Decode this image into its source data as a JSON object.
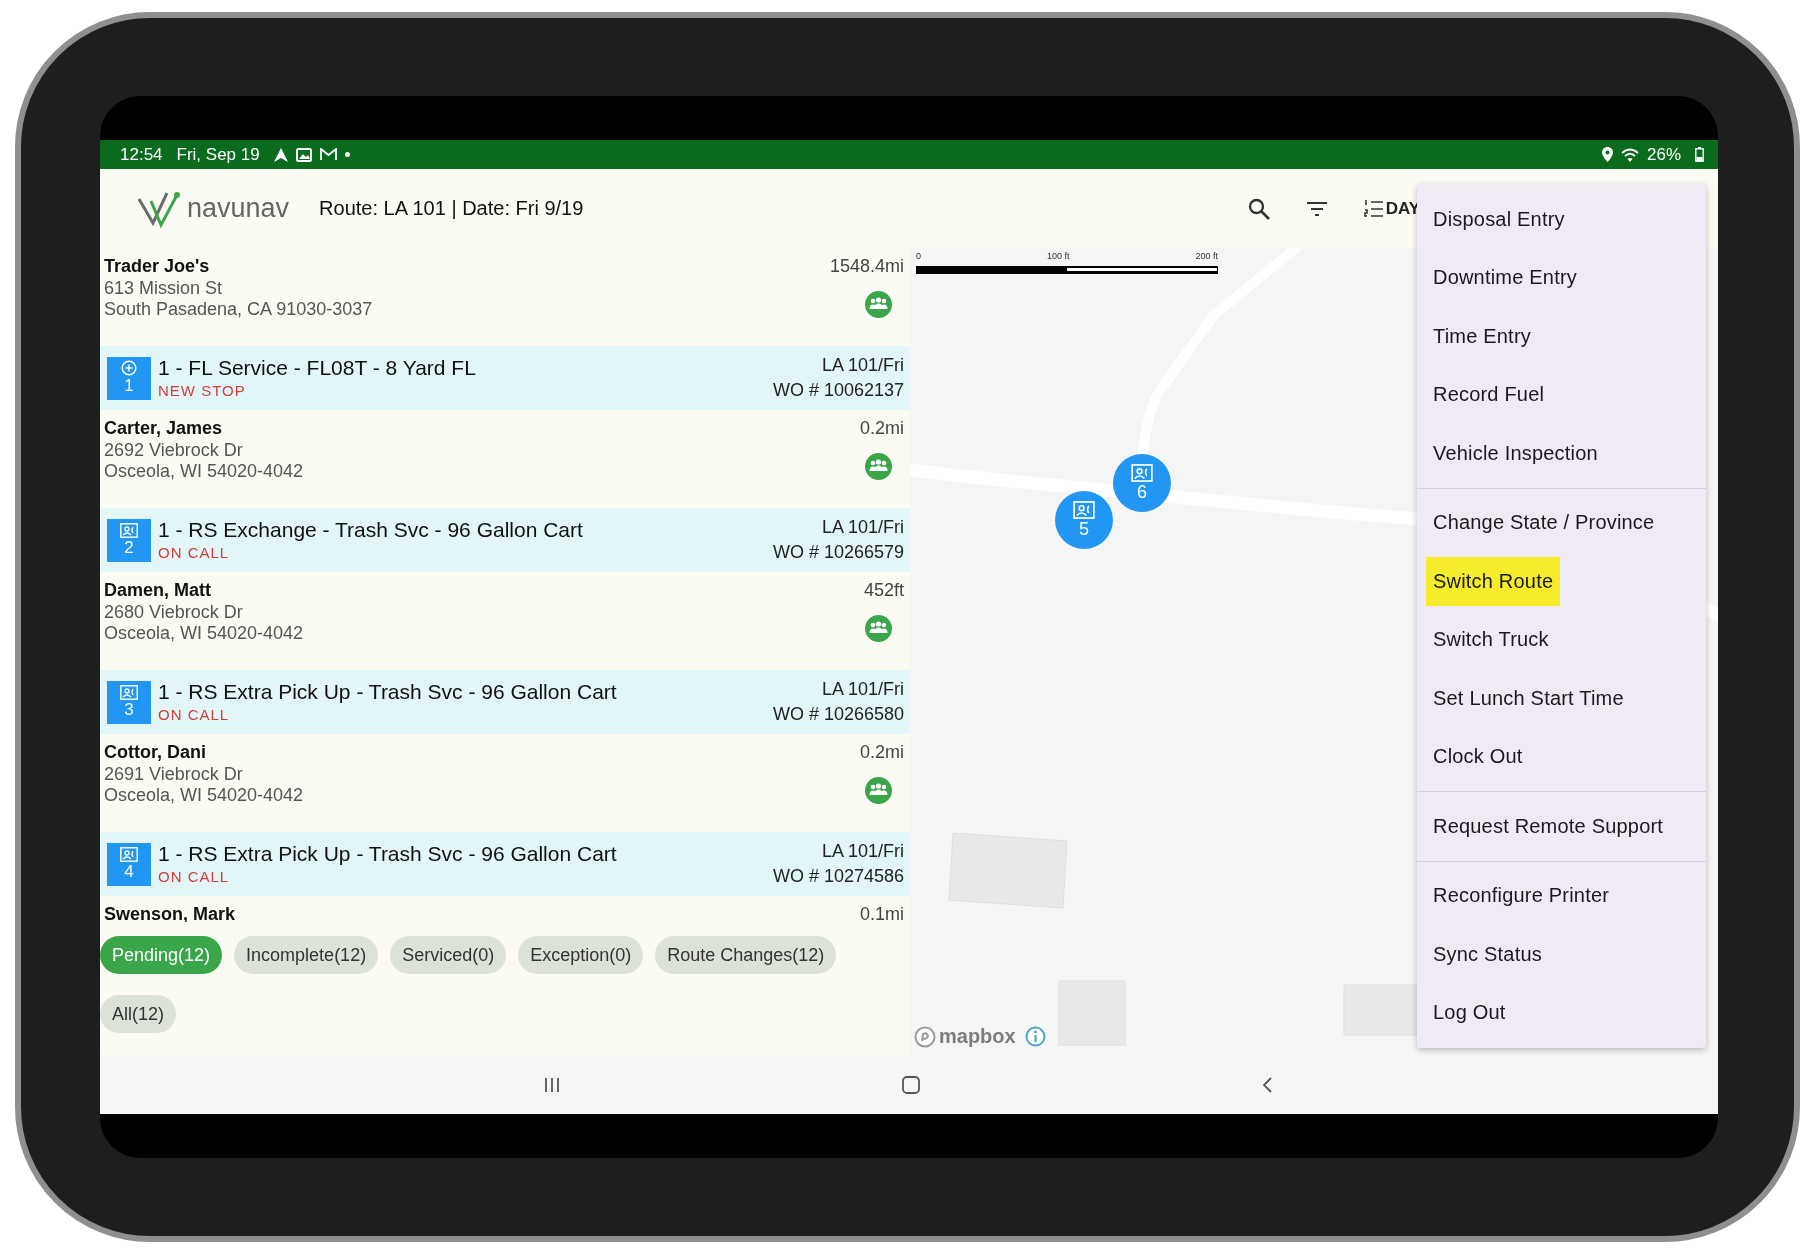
{
  "status_bar": {
    "time": "12:54",
    "date": "Fri, Sep 19",
    "battery": "26%"
  },
  "header": {
    "logo": "navunav",
    "route": "Route: LA 101 | Date: Fri 9/19",
    "view_button": "DAY"
  },
  "stops": [
    {
      "customer": {
        "name": "Trader Joe's",
        "distance": "1548.4mi",
        "address": [
          "613 Mission St",
          "South Pasadena, CA 91030-3037"
        ]
      },
      "order": {
        "kind": "new",
        "number": "1",
        "title": "1 - FL Service - FL08T - 8 Yard FL",
        "status": "NEW STOP",
        "route": "LA 101/Fri",
        "work_order": "WO # 10062137"
      }
    },
    {
      "customer": {
        "name": "Carter, James",
        "distance": "0.2mi",
        "address": [
          "2692 Viebrock Dr",
          "Osceola, WI 54020-4042"
        ]
      },
      "order": {
        "kind": "on_call",
        "number": "2",
        "title": "1 - RS Exchange - Trash Svc - 96 Gallon Cart",
        "status": "ON CALL",
        "route": "LA 101/Fri",
        "work_order": "WO # 10266579"
      }
    },
    {
      "customer": {
        "name": "Damen, Matt",
        "distance": "452ft",
        "address": [
          "2680 Viebrock Dr",
          "Osceola, WI 54020-4042"
        ]
      },
      "order": {
        "kind": "on_call",
        "number": "3",
        "title": "1 - RS Extra Pick Up - Trash Svc - 96 Gallon Cart",
        "status": "ON CALL",
        "route": "LA 101/Fri",
        "work_order": "WO # 10266580"
      }
    },
    {
      "customer": {
        "name": "Cottor, Dani",
        "distance": "0.2mi",
        "address": [
          "2691 Viebrock Dr",
          "Osceola, WI 54020-4042"
        ]
      },
      "order": {
        "kind": "on_call",
        "number": "4",
        "title": "1 - RS Extra Pick Up - Trash Svc - 96 Gallon Cart",
        "status": "ON CALL",
        "route": "LA 101/Fri",
        "work_order": "WO # 10274586"
      }
    },
    {
      "customer": {
        "name": "Swenson, Mark",
        "distance": "0.1mi"
      }
    }
  ],
  "filter_rows": [
    [
      {
        "label": "Pending(12)",
        "selected": true
      },
      {
        "label": "Incomplete(12)",
        "selected": false
      },
      {
        "label": "Serviced(0)",
        "selected": false
      },
      {
        "label": "Exception(0)",
        "selected": false
      },
      {
        "label": "Route Changes(12)",
        "selected": false
      }
    ],
    [
      {
        "label": "All(12)",
        "selected": false
      }
    ]
  ],
  "map": {
    "scale_labels": [
      "0",
      "100 ft",
      "200 ft"
    ],
    "markers": [
      {
        "label": "6"
      },
      {
        "label": "5"
      }
    ],
    "attribution": "mapbox"
  },
  "menu": {
    "groups": [
      {
        "items": [
          {
            "label": "Disposal Entry",
            "highlighted": false
          },
          {
            "label": "Downtime Entry",
            "highlighted": false
          },
          {
            "label": "Time Entry",
            "highlighted": false
          },
          {
            "label": "Record Fuel",
            "highlighted": false
          },
          {
            "label": "Vehicle Inspection",
            "highlighted": false
          }
        ]
      },
      {
        "items": [
          {
            "label": "Change State / Province",
            "highlighted": false
          },
          {
            "label": "Switch Route",
            "highlighted": true
          },
          {
            "label": "Switch Truck",
            "highlighted": false
          },
          {
            "label": "Set Lunch Start Time",
            "highlighted": false
          },
          {
            "label": "Clock Out",
            "highlighted": false
          }
        ]
      },
      {
        "items": [
          {
            "label": "Request Remote Support",
            "highlighted": false
          }
        ]
      },
      {
        "items": [
          {
            "label": "Reconfigure Printer",
            "highlighted": false
          },
          {
            "label": "Sync Status",
            "highlighted": false
          },
          {
            "label": "Log Out",
            "highlighted": false
          }
        ]
      }
    ]
  }
}
